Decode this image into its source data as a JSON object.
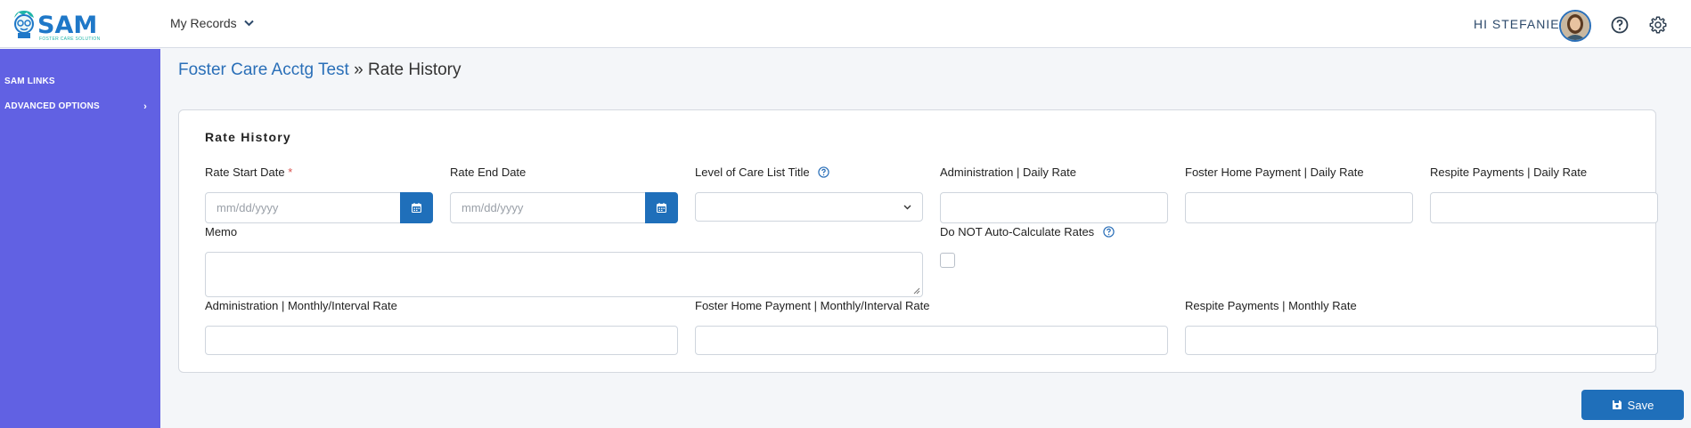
{
  "header": {
    "logo_text": "SAM",
    "logo_subtext": "FOSTER CARE SOLUTION",
    "nav_records_label": "My Records",
    "greeting": "HI STEFANIE"
  },
  "sidebar": {
    "items": [
      {
        "label": "SAM LINKS"
      },
      {
        "label": "ADVANCED OPTIONS"
      }
    ]
  },
  "breadcrumb": {
    "parent": "Foster Care Acctg Test",
    "separator": " » ",
    "current": "Rate History"
  },
  "form": {
    "title": "Rate History",
    "rate_start_date": {
      "label": "Rate Start Date",
      "required_mark": "*",
      "placeholder": "mm/dd/yyyy",
      "value": ""
    },
    "rate_end_date": {
      "label": "Rate End Date",
      "placeholder": "mm/dd/yyyy",
      "value": ""
    },
    "level_of_care": {
      "label": "Level of Care List Title",
      "selected": ""
    },
    "admin_daily": {
      "label": "Administration | Daily Rate",
      "value": ""
    },
    "foster_daily": {
      "label": "Foster Home Payment | Daily Rate",
      "value": ""
    },
    "respite_daily": {
      "label": "Respite Payments | Daily Rate",
      "value": ""
    },
    "memo": {
      "label": "Memo",
      "value": ""
    },
    "no_auto_calc": {
      "label": "Do NOT Auto-Calculate Rates",
      "checked": false
    },
    "admin_monthly": {
      "label": "Administration | Monthly/Interval Rate",
      "value": ""
    },
    "foster_monthly": {
      "label": "Foster Home Payment | Monthly/Interval Rate",
      "value": ""
    },
    "respite_monthly": {
      "label": "Respite Payments | Monthly Rate",
      "value": ""
    }
  },
  "save_label": "Save",
  "colors": {
    "sidebar": "#6161e3",
    "primary": "#1f6fba",
    "link": "#2a6fb8",
    "required": "#d9534f"
  }
}
